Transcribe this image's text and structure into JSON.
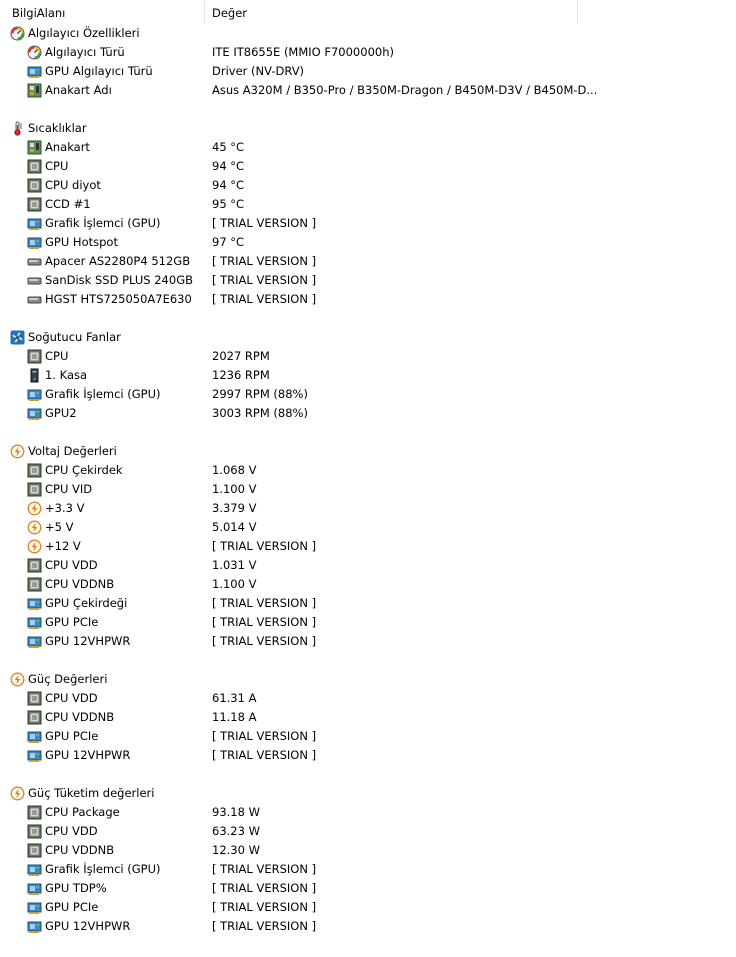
{
  "header": {
    "col1": "BilgiAlanı",
    "col2": "Değer"
  },
  "sections": [
    {
      "title": "Algılayıcı Özellikleri",
      "icon": "sensor-gauge-icon",
      "items": [
        {
          "label": "Algılayıcı Türü",
          "value": "ITE IT8655E  (MMIO F7000000h)",
          "icon": "sensor-gauge-icon"
        },
        {
          "label": "GPU Algılayıcı Türü",
          "value": "Driver  (NV-DRV)",
          "icon": "gpu-card-icon"
        },
        {
          "label": "Anakart Adı",
          "value": "Asus A320M / B350-Pro / B350M-Dragon / B450M-D3V / B450M-D...",
          "icon": "motherboard-icon"
        }
      ]
    },
    {
      "title": "Sıcaklıklar",
      "icon": "thermometer-icon",
      "items": [
        {
          "label": "Anakart",
          "value": "45 °C",
          "icon": "motherboard-icon"
        },
        {
          "label": "CPU",
          "value": "94 °C",
          "icon": "cpu-chip-icon"
        },
        {
          "label": "CPU diyot",
          "value": "94 °C",
          "icon": "cpu-chip-icon"
        },
        {
          "label": "CCD #1",
          "value": "95 °C",
          "icon": "cpu-chip-icon"
        },
        {
          "label": "Grafik İşlemci (GPU)",
          "value": "[ TRIAL VERSION ]",
          "icon": "gpu-card-icon"
        },
        {
          "label": "GPU Hotspot",
          "value": "97 °C",
          "icon": "gpu-card-icon"
        },
        {
          "label": "Apacer AS2280P4 512GB",
          "value": "[ TRIAL VERSION ]",
          "icon": "disk-drive-icon"
        },
        {
          "label": "SanDisk SSD PLUS 240GB",
          "value": "[ TRIAL VERSION ]",
          "icon": "disk-drive-icon"
        },
        {
          "label": "HGST HTS725050A7E630",
          "value": "[ TRIAL VERSION ]",
          "icon": "disk-drive-icon"
        }
      ]
    },
    {
      "title": "Soğutucu Fanlar",
      "icon": "fan-icon",
      "items": [
        {
          "label": "CPU",
          "value": "2027 RPM",
          "icon": "cpu-chip-icon"
        },
        {
          "label": "1. Kasa",
          "value": "1236 RPM",
          "icon": "pc-case-icon"
        },
        {
          "label": "Grafik İşlemci (GPU)",
          "value": "2997 RPM  (88%)",
          "icon": "gpu-card-icon"
        },
        {
          "label": "GPU2",
          "value": "3003 RPM  (88%)",
          "icon": "gpu-card-icon"
        }
      ]
    },
    {
      "title": "Voltaj Değerleri",
      "icon": "voltage-bolt-icon",
      "items": [
        {
          "label": "CPU Çekirdek",
          "value": "1.068 V",
          "icon": "cpu-chip-icon"
        },
        {
          "label": "CPU VID",
          "value": "1.100 V",
          "icon": "cpu-chip-icon"
        },
        {
          "label": "+3.3 V",
          "value": "3.379 V",
          "icon": "voltage-bolt-icon"
        },
        {
          "label": "+5 V",
          "value": "5.014 V",
          "icon": "voltage-bolt-icon"
        },
        {
          "label": "+12 V",
          "value": "[ TRIAL VERSION ]",
          "icon": "voltage-bolt-icon"
        },
        {
          "label": "CPU VDD",
          "value": "1.031 V",
          "icon": "cpu-chip-icon"
        },
        {
          "label": "CPU VDDNB",
          "value": "1.100 V",
          "icon": "cpu-chip-icon"
        },
        {
          "label": "GPU Çekirdeği",
          "value": "[ TRIAL VERSION ]",
          "icon": "gpu-card-icon"
        },
        {
          "label": "GPU PCIe",
          "value": "[ TRIAL VERSION ]",
          "icon": "gpu-card-icon"
        },
        {
          "label": "GPU 12VHPWR",
          "value": "[ TRIAL VERSION ]",
          "icon": "gpu-card-icon"
        }
      ]
    },
    {
      "title": "Güç Değerleri",
      "icon": "voltage-bolt-icon",
      "items": [
        {
          "label": "CPU VDD",
          "value": "61.31 A",
          "icon": "cpu-chip-icon"
        },
        {
          "label": "CPU VDDNB",
          "value": "11.18 A",
          "icon": "cpu-chip-icon"
        },
        {
          "label": "GPU PCIe",
          "value": "[ TRIAL VERSION ]",
          "icon": "gpu-card-icon"
        },
        {
          "label": "GPU 12VHPWR",
          "value": "[ TRIAL VERSION ]",
          "icon": "gpu-card-icon"
        }
      ]
    },
    {
      "title": "Güç Tüketim değerleri",
      "icon": "voltage-bolt-icon",
      "items": [
        {
          "label": "CPU Package",
          "value": "93.18 W",
          "icon": "cpu-chip-icon"
        },
        {
          "label": "CPU VDD",
          "value": "63.23 W",
          "icon": "cpu-chip-icon"
        },
        {
          "label": "CPU VDDNB",
          "value": "12.30 W",
          "icon": "cpu-chip-icon"
        },
        {
          "label": "Grafik İşlemci (GPU)",
          "value": "[ TRIAL VERSION ]",
          "icon": "gpu-card-icon"
        },
        {
          "label": "GPU TDP%",
          "value": "[ TRIAL VERSION ]",
          "icon": "gpu-card-icon"
        },
        {
          "label": "GPU PCIe",
          "value": "[ TRIAL VERSION ]",
          "icon": "gpu-card-icon"
        },
        {
          "label": "GPU 12VHPWR",
          "value": "[ TRIAL VERSION ]",
          "icon": "gpu-card-icon"
        }
      ]
    }
  ]
}
